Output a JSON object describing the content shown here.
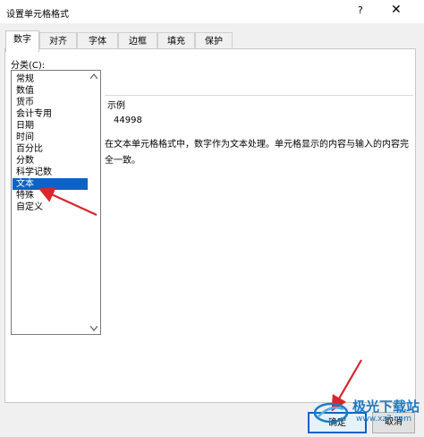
{
  "window": {
    "title": "设置单元格格式",
    "help": "?",
    "close": "✕"
  },
  "tabs": [
    {
      "label": "数字",
      "active": true
    },
    {
      "label": "对齐"
    },
    {
      "label": "字体"
    },
    {
      "label": "边框"
    },
    {
      "label": "填充"
    },
    {
      "label": "保护"
    }
  ],
  "category": {
    "label": "分类(C):",
    "items": [
      "常规",
      "数值",
      "货币",
      "会计专用",
      "日期",
      "时间",
      "百分比",
      "分数",
      "科学记数",
      "文本",
      "特殊",
      "自定义"
    ],
    "selected": "文本"
  },
  "sample": {
    "label": "示例",
    "value": "44998"
  },
  "description": "在文本单元格格式中，数字作为文本处理。单元格显示的内容与输入的内容完全一致。",
  "buttons": {
    "ok": "确定",
    "cancel": "取消"
  },
  "watermark": {
    "main": "极光下载站",
    "url": "www.xz7.com"
  },
  "colors": {
    "selection": "#0a64c8",
    "annotation": "#d9262b",
    "watermark": "#1a7bc4"
  }
}
